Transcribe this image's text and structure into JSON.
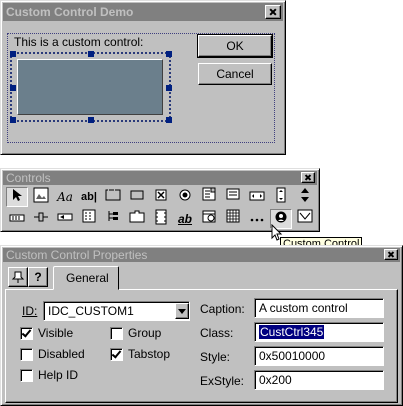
{
  "demo_dialog": {
    "title": "Custom Control Demo",
    "static_text": "This is a custom control:",
    "ok_label": "OK",
    "cancel_label": "Cancel",
    "control_color": "#6b7f8c"
  },
  "controls_toolbar": {
    "title": "Controls",
    "tooltip": "Custom Control",
    "row1": [
      "pointer",
      "picture",
      "static-text",
      "edit-box",
      "group-box",
      "button",
      "checkbox",
      "radio-button",
      "combo-box",
      "list-box",
      "horizontal-scrollbar",
      "vertical-scrollbar"
    ],
    "row2": [
      "slider",
      "spin",
      "progress",
      "hotkey",
      "list-control",
      "tree-control",
      "tab-control",
      "animate",
      "rich-edit",
      "date-time-picker",
      "month-calendar",
      "ip-address",
      "custom-control",
      "extended-combo"
    ],
    "glyphs": {
      "static_text": "Aa",
      "edit_box": "ab|",
      "rich_edit": "ab"
    }
  },
  "properties": {
    "title": "Custom Control Properties",
    "tab_label": "General",
    "id_label": "ID:",
    "id_value": "IDC_CUSTOM1",
    "caption_label": "Caption:",
    "caption_value": "A custom control",
    "class_label": "Class:",
    "class_value": "CustCtrl345",
    "style_label": "Style:",
    "style_value": "0x50010000",
    "exstyle_label": "ExStyle:",
    "exstyle_value": "0x200",
    "visible_label": "Visible",
    "visible_checked": true,
    "group_label": "Group",
    "group_checked": false,
    "disabled_label": "Disabled",
    "disabled_checked": false,
    "tabstop_label": "Tabstop",
    "tabstop_checked": true,
    "helpid_label": "Help ID",
    "helpid_checked": false
  }
}
